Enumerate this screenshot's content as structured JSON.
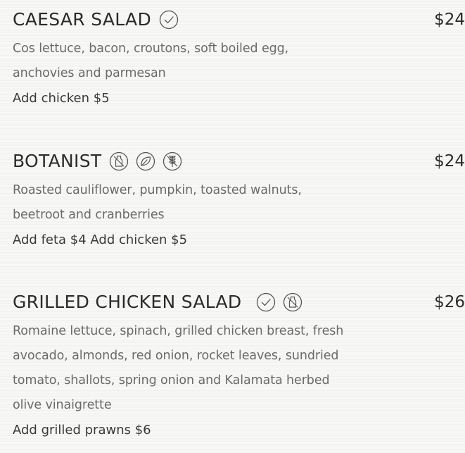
{
  "menu": {
    "items": [
      {
        "name": "CAESAR SALAD",
        "price": "$24",
        "description_lines": [
          "Cos lettuce, bacon, croutons, soft boiled egg,",
          "anchovies and parmesan"
        ],
        "addon": "Add chicken $5",
        "icons": [
          "check-circle-icon"
        ]
      },
      {
        "name": "BOTANIST",
        "price": "$24",
        "description_lines": [
          "Roasted cauliflower, pumpkin, toasted walnuts,",
          "beetroot and cranberries"
        ],
        "addon": "Add feta $4 Add chicken $5",
        "icons": [
          "dairy-free-bottle-icon",
          "vegan-leaf-icon",
          "gluten-free-wheat-icon"
        ]
      },
      {
        "name": "GRILLED CHICKEN SALAD",
        "price": "$26",
        "description_lines": [
          "Romaine lettuce, spinach, grilled chicken breast, fresh",
          "avocado, almonds, red onion, rocket leaves, sundried",
          "tomato, shallots, spring onion and Kalamata herbed",
          "olive vinaigrette"
        ],
        "addon": "Add grilled prawns $6",
        "icons": [
          "check-circle-icon",
          "dairy-free-bottle-icon"
        ]
      }
    ]
  }
}
